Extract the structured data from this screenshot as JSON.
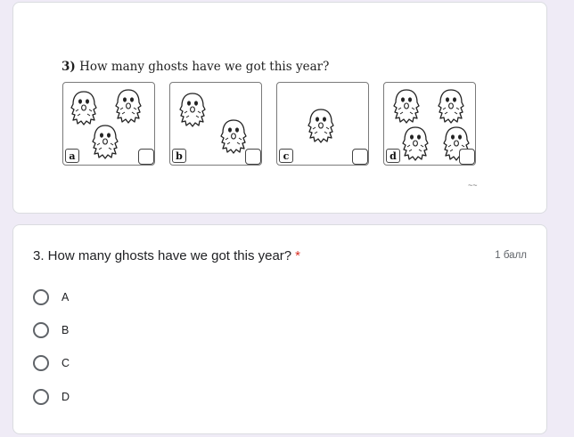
{
  "image_card": {
    "title_number": "3)",
    "title_text": "How many ghosts have we got this year?",
    "boxes": [
      {
        "letter": "a",
        "ghost_count": 3
      },
      {
        "letter": "b",
        "ghost_count": 2
      },
      {
        "letter": "c",
        "ghost_count": 1
      },
      {
        "letter": "d",
        "ghost_count": 4
      }
    ],
    "marks": "~~"
  },
  "question": {
    "text": "3. How many ghosts have we got this year?",
    "required_mark": "*",
    "points": "1 балл",
    "options": [
      "A",
      "B",
      "C",
      "D"
    ]
  },
  "colors": {
    "background": "#efebf6",
    "required": "#d93025"
  }
}
